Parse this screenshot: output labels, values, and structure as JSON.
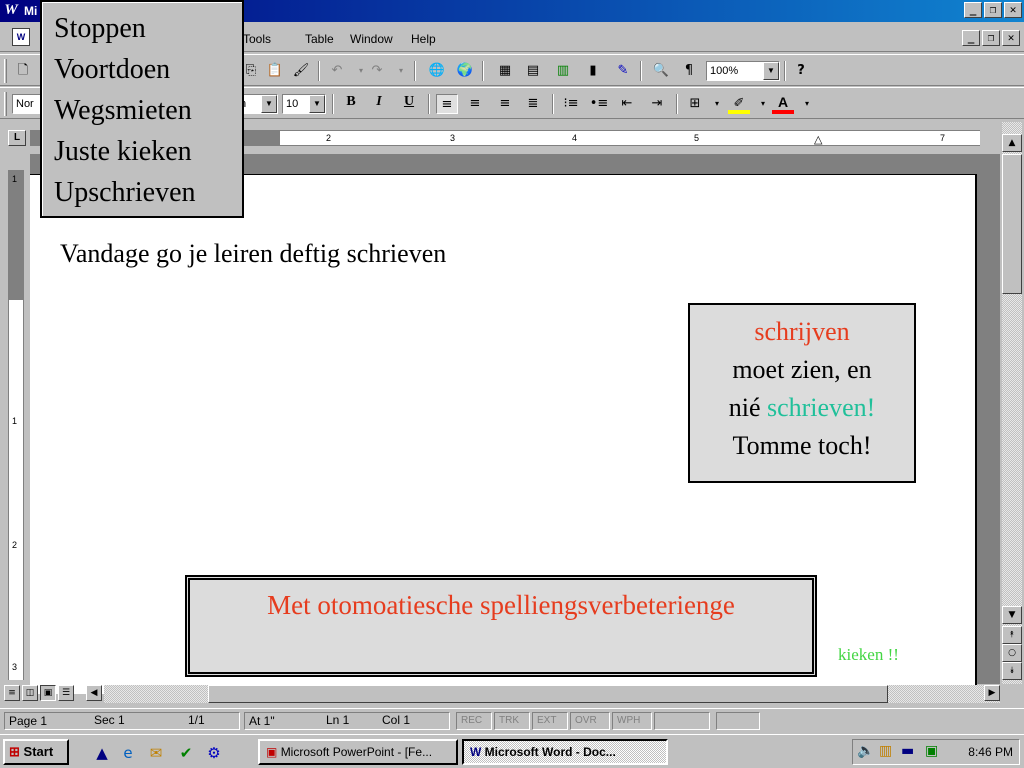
{
  "window": {
    "app_icon": "W",
    "title": "Microsoft Word - Doc..."
  },
  "menubar": {
    "items": [
      "Tools",
      "Table",
      "Window",
      "Help"
    ]
  },
  "toolbar": {
    "zoom": "100%",
    "style": "Nor",
    "font_tail": "n",
    "font_size": "10",
    "bold": "B",
    "italic": "I",
    "underline": "U"
  },
  "ruler": {
    "marks": [
      "2",
      "3",
      "4",
      "5",
      "7"
    ],
    "vmarks": [
      "1",
      "1",
      "2",
      "3"
    ]
  },
  "popup_menu": {
    "items": [
      "Stoppen",
      "Voortdoen",
      "Wegsmieten",
      "Juste kieken",
      "Upschrieven"
    ]
  },
  "document": {
    "body_line": "Vandage go je leiren deftig schrieven",
    "callout": {
      "word1": "schrijven",
      "line2": "moet zien, en",
      "line3_prefix": "nié",
      "word2": "schrieven!",
      "line4": "Tomme toch!"
    },
    "spell_box": "Met otomoatiesche spelliengsverbeterienge",
    "kieken": "kieken !!"
  },
  "statusbar": {
    "page": "Page 1",
    "sec": "Sec 1",
    "pages": "1/1",
    "at": "At 1\"",
    "ln": "Ln 1",
    "col": "Col 1",
    "modes": [
      "REC",
      "TRK",
      "EXT",
      "OVR",
      "WPH"
    ]
  },
  "taskbar": {
    "start": "Start",
    "tasks": [
      "Microsoft PowerPoint - [Fe...",
      "Microsoft Word - Doc..."
    ],
    "clock": "8:46 PM"
  },
  "colors": {
    "red": "#e63c1e",
    "teal": "#20c09a",
    "green": "#44d644",
    "titlebar": "#000080"
  }
}
